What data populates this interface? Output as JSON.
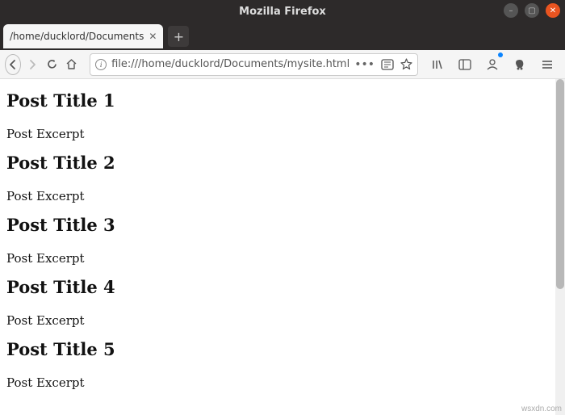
{
  "window": {
    "title": "Mozilla Firefox"
  },
  "tab": {
    "title": "/home/ducklord/Documents"
  },
  "urlbar": {
    "url": "file:///home/ducklord/Documents/mysite.html"
  },
  "posts": [
    {
      "title": "Post Title 1",
      "excerpt": "Post Excerpt"
    },
    {
      "title": "Post Title 2",
      "excerpt": "Post Excerpt"
    },
    {
      "title": "Post Title 3",
      "excerpt": "Post Excerpt"
    },
    {
      "title": "Post Title 4",
      "excerpt": "Post Excerpt"
    },
    {
      "title": "Post Title 5",
      "excerpt": "Post Excerpt"
    }
  ],
  "watermark": "wsxdn.com"
}
